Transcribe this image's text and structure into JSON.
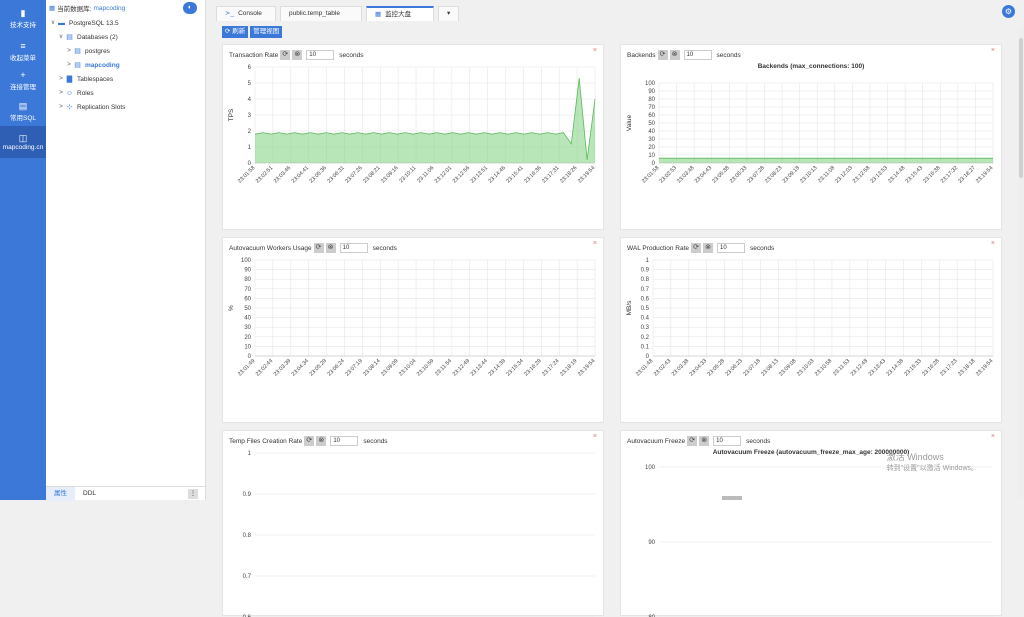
{
  "sidebar": {
    "items": [
      {
        "icon": "bookmark-icon",
        "glyph": "▮",
        "label": "技术支持"
      },
      {
        "icon": "menu-icon",
        "glyph": "≡",
        "label": "收起菜单"
      },
      {
        "icon": "plus-icon",
        "glyph": "+",
        "label": "连接管理"
      },
      {
        "icon": "database-icon",
        "glyph": "▤",
        "label": "常用SQL"
      },
      {
        "icon": "plugin-icon",
        "glyph": "◫",
        "label": "mapcoding.cn"
      }
    ]
  },
  "tree": {
    "current_db_label": "当前数据库:",
    "current_db": "mapcoding",
    "nodes": [
      {
        "level": 0,
        "arrow": "v",
        "label": "PostgreSQL 13.5"
      },
      {
        "level": 1,
        "arrow": "v",
        "label": "Databases (2)"
      },
      {
        "level": 2,
        "arrow": ">",
        "label": "postgres"
      },
      {
        "level": 2,
        "arrow": ">",
        "label": "mapcoding",
        "bold": true
      },
      {
        "level": 1,
        "arrow": ">",
        "label": "Tablespaces"
      },
      {
        "level": 1,
        "arrow": ">",
        "label": "Roles"
      },
      {
        "level": 1,
        "arrow": ">",
        "label": "Replication Slots"
      }
    ],
    "bottom_tabs": [
      "属性",
      "DDL"
    ]
  },
  "tabs": [
    {
      "label": "Console",
      "icon": "terminal-icon",
      "glyph": "≻_"
    },
    {
      "label": "public.temp_table",
      "icon": "",
      "glyph": ""
    },
    {
      "label": "监控大盘",
      "icon": "chart-icon",
      "glyph": "▦",
      "active": true
    },
    {
      "label": "▾",
      "icon": "",
      "glyph": ""
    }
  ],
  "actions": {
    "refresh": "⟳ 刷新",
    "manage": "管理视图"
  },
  "panels": [
    {
      "title": "Transaction Rate",
      "interval": "10",
      "unit": "seconds",
      "chart_title": "",
      "ylabel": "TPS"
    },
    {
      "title": "Backends",
      "interval": "10",
      "unit": "seconds",
      "chart_title": "Backends (max_connections: 100)",
      "ylabel": "Value"
    },
    {
      "title": "Autovacuum Workers Usage",
      "interval": "10",
      "unit": "seconds",
      "chart_title": "",
      "ylabel": "%"
    },
    {
      "title": "WAL Production Rate",
      "interval": "10",
      "unit": "seconds",
      "chart_title": "",
      "ylabel": "MB/s"
    },
    {
      "title": "Temp Files Creation Rate",
      "interval": "10",
      "unit": "seconds",
      "chart_title": "",
      "ylabel": ""
    },
    {
      "title": "Autovacuum Freeze",
      "interval": "10",
      "unit": "seconds",
      "chart_title": "Autovacuum Freeze (autovacuum_freeze_max_age: 200000000)",
      "ylabel": ""
    }
  ],
  "watermark": {
    "line1": "激活 Windows",
    "line2": "转到\"设置\"以激活 Windows。"
  },
  "chart_data": [
    {
      "type": "area",
      "title": "",
      "ylabel": "TPS",
      "ylim": [
        0,
        6
      ],
      "yticks": [
        0,
        1,
        2,
        3,
        4,
        5,
        6
      ],
      "x": [
        "23:01:58",
        "23:02:51",
        "23:03:46",
        "23:04:41",
        "23:05:36",
        "23:06:31",
        "23:07:26",
        "23:08:21",
        "23:09:16",
        "23:10:11",
        "23:11:06",
        "23:12:01",
        "23:12:56",
        "23:13:51",
        "23:14:46",
        "23:15:41",
        "23:16:36",
        "23:17:31",
        "23:18:26",
        "23:19:54"
      ],
      "values": [
        1.8,
        1.9,
        1.8,
        1.9,
        1.8,
        1.9,
        1.8,
        1.9,
        1.8,
        1.9,
        1.8,
        1.9,
        1.8,
        1.9,
        1.8,
        1.9,
        1.8,
        1.9,
        1.8,
        1.9,
        1.8,
        1.9,
        1.8,
        1.9,
        1.8,
        1.9,
        1.8,
        1.9,
        1.8,
        1.9,
        1.8,
        1.9,
        1.8,
        1.9,
        1.8,
        1.9,
        1.8,
        1.9,
        1.8,
        1.9,
        1.2,
        5.3,
        0.2,
        4.0
      ],
      "color": "#7ed17e"
    },
    {
      "type": "area",
      "title": "Backends (max_connections: 100)",
      "ylabel": "Value",
      "ylim": [
        0,
        100
      ],
      "yticks": [
        0,
        10,
        20,
        30,
        40,
        50,
        60,
        70,
        80,
        90,
        100
      ],
      "x": [
        "23:01:58",
        "23:02:53",
        "23:03:48",
        "23:04:43",
        "23:05:38",
        "23:06:33",
        "23:07:28",
        "23:08:23",
        "23:09:18",
        "23:10:13",
        "23:11:08",
        "23:12:03",
        "23:12:58",
        "23:13:53",
        "23:14:48",
        "23:15:43",
        "23:16:38",
        "23:17:32",
        "23:18:27",
        "23:19:54"
      ],
      "values": [
        6,
        6,
        6,
        6,
        6,
        6,
        6,
        6,
        6,
        6,
        6,
        6,
        6,
        6,
        6,
        6,
        6,
        6,
        6,
        6
      ],
      "color": "#7ed17e"
    },
    {
      "type": "line",
      "title": "",
      "ylabel": "%",
      "ylim": [
        0,
        100
      ],
      "yticks": [
        0,
        10,
        20,
        30,
        40,
        50,
        60,
        70,
        80,
        90,
        100
      ],
      "x": [
        "23:01:49",
        "23:02:44",
        "23:03:39",
        "23:04:34",
        "23:05:29",
        "23:06:24",
        "23:07:19",
        "23:08:14",
        "23:09:09",
        "23:10:04",
        "23:10:59",
        "23:11:54",
        "23:12:49",
        "23:13:44",
        "23:14:39",
        "23:15:34",
        "23:16:29",
        "23:17:24",
        "23:18:19",
        "23:19:54"
      ],
      "values": []
    },
    {
      "type": "line",
      "title": "",
      "ylabel": "MB/s",
      "ylim": [
        0,
        1
      ],
      "yticks": [
        0,
        0.1,
        0.2,
        0.3,
        0.4,
        0.5,
        0.6,
        0.7,
        0.8,
        0.9,
        1.0
      ],
      "x": [
        "23:01:48",
        "23:02:43",
        "23:03:38",
        "23:04:33",
        "23:05:28",
        "23:06:23",
        "23:07:18",
        "23:08:13",
        "23:09:08",
        "23:10:03",
        "23:10:58",
        "23:11:53",
        "23:12:48",
        "23:13:43",
        "23:14:38",
        "23:15:33",
        "23:16:28",
        "23:17:23",
        "23:18:18",
        "23:19:54"
      ],
      "values": []
    },
    {
      "type": "line",
      "title": "",
      "ylabel": "",
      "ylim": [
        0.6,
        1
      ],
      "yticks": [
        0.6,
        0.7,
        0.8,
        0.9,
        1.0
      ],
      "x": [],
      "values": []
    },
    {
      "type": "line",
      "title": "Autovacuum Freeze (autovacuum_freeze_max_age: 200000000)",
      "ylabel": "",
      "ylim": [
        80,
        100
      ],
      "yticks": [
        80,
        90,
        100
      ],
      "x": [],
      "values": []
    }
  ]
}
